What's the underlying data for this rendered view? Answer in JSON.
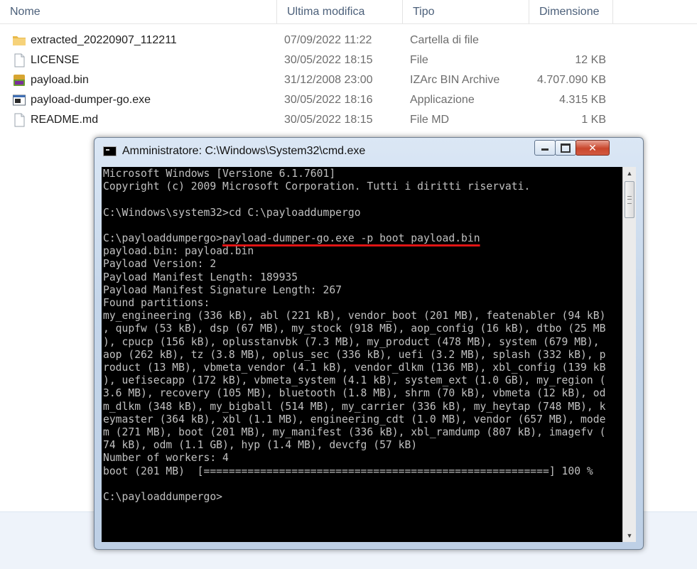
{
  "explorer": {
    "columns": {
      "name": "Nome",
      "modified": "Ultima modifica",
      "type": "Tipo",
      "size": "Dimensione"
    },
    "files": [
      {
        "name": "extracted_20220907_112211",
        "modified": "07/09/2022 11:22",
        "type": "Cartella di file",
        "size": "",
        "icon": "folder-icon"
      },
      {
        "name": "LICENSE",
        "modified": "30/05/2022 18:15",
        "type": "File",
        "size": "12 KB",
        "icon": "file-icon"
      },
      {
        "name": "payload.bin",
        "modified": "31/12/2008 23:00",
        "type": "IZArc BIN Archive",
        "size": "4.707.090 KB",
        "icon": "archive-icon"
      },
      {
        "name": "payload-dumper-go.exe",
        "modified": "30/05/2022 18:16",
        "type": "Applicazione",
        "size": "4.315 KB",
        "icon": "exe-icon"
      },
      {
        "name": "README.md",
        "modified": "30/05/2022 18:15",
        "type": "File MD",
        "size": "1 KB",
        "icon": "file-icon"
      }
    ]
  },
  "cmd": {
    "title": "Amministratore: C:\\Windows\\System32\\cmd.exe",
    "buttons": {
      "minimize": "minimize",
      "maximize": "maximize",
      "close": "✕"
    },
    "lines_before": [
      "Microsoft Windows [Versione 6.1.7601]",
      "Copyright (c) 2009 Microsoft Corporation. Tutti i diritti riservati.",
      "",
      "C:\\Windows\\system32>cd C:\\payloaddumpergo",
      ""
    ],
    "prompt": "C:\\payloaddumpergo>",
    "command": "payload-dumper-go.exe -p boot payload.bin",
    "lines_after": [
      "payload.bin: payload.bin",
      "Payload Version: 2",
      "Payload Manifest Length: 189935",
      "Payload Manifest Signature Length: 267",
      "Found partitions:",
      "my_engineering (336 kB), abl (221 kB), vendor_boot (201 MB), featenabler (94 kB)",
      ", qupfw (53 kB), dsp (67 MB), my_stock (918 MB), aop_config (16 kB), dtbo (25 MB",
      "), cpucp (156 kB), oplusstanvbk (7.3 MB), my_product (478 MB), system (679 MB),",
      "aop (262 kB), tz (3.8 MB), oplus_sec (336 kB), uefi (3.2 MB), splash (332 kB), p",
      "roduct (13 MB), vbmeta_vendor (4.1 kB), vendor_dlkm (136 MB), xbl_config (139 kB",
      "), uefisecapp (172 kB), vbmeta_system (4.1 kB), system_ext (1.0 GB), my_region (",
      "3.6 MB), recovery (105 MB), bluetooth (1.8 MB), shrm (70 kB), vbmeta (12 kB), od",
      "m_dlkm (348 kB), my_bigball (514 MB), my_carrier (336 kB), my_heytap (748 MB), k",
      "eymaster (364 kB), xbl (1.1 MB), engineering_cdt (1.0 MB), vendor (657 MB), mode",
      "m (271 MB), boot (201 MB), my_manifest (336 kB), xbl_ramdump (807 kB), imagefv (",
      "74 kB), odm (1.1 GB), hyp (1.4 MB), devcfg (57 kB)",
      "Number of workers: 4",
      "boot (201 MB)  [=======================================================] 100 %",
      "",
      "C:\\payloaddumpergo>"
    ]
  }
}
